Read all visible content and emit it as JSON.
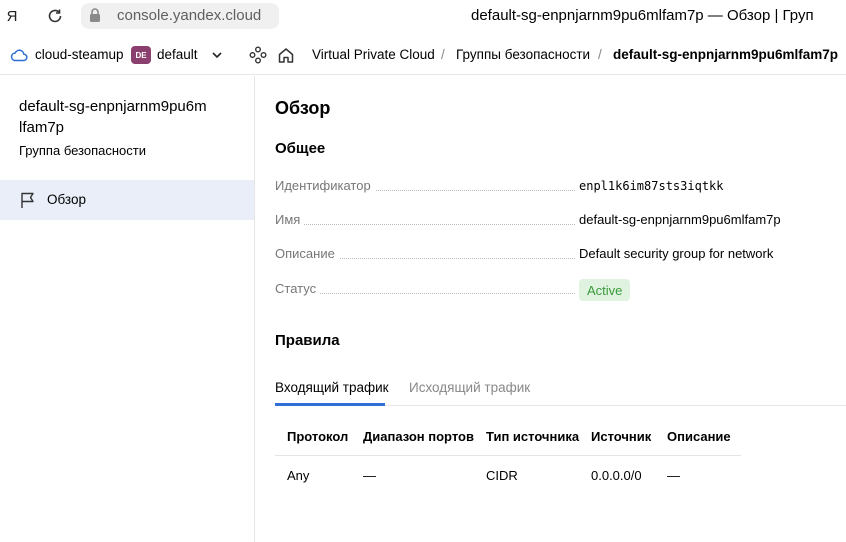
{
  "browser": {
    "logo": "Я",
    "address": "console.yandex.cloud",
    "tab_title": "default-sg-enpnjarnm9pu6mlfam7p — Обзор | Груп"
  },
  "header": {
    "cloud_name": "cloud-steamup",
    "folder_badge": "DE",
    "folder_name": "default",
    "breadcrumbs": [
      {
        "label": "Virtual Private Cloud"
      },
      {
        "label": "Группы безопасности"
      },
      {
        "label": "default-sg-enpnjarnm9pu6mlfam7p"
      }
    ],
    "separator": "/"
  },
  "sidebar": {
    "resource_name": "default-sg-enpnjarnm9pu6mlfam7p",
    "resource_type": "Группа безопасности",
    "items": [
      {
        "label": "Обзор",
        "icon": "flag-icon",
        "active": true
      }
    ]
  },
  "main": {
    "title": "Обзор",
    "general_title": "Общее",
    "properties": [
      {
        "label": "Идентификатор",
        "value": "enpl1k6im87sts3iqtkk"
      },
      {
        "label": "Имя",
        "value": "default-sg-enpnjarnm9pu6mlfam7p"
      },
      {
        "label": "Описание",
        "value": "Default security group for network"
      },
      {
        "label": "Статус",
        "value": "Active"
      }
    ],
    "rules_title": "Правила",
    "tabs": [
      {
        "label": "Входящий трафик",
        "active": true
      },
      {
        "label": "Исходящий трафик",
        "active": false
      }
    ],
    "table": {
      "headers": [
        "Протокол",
        "Диапазон портов",
        "Тип источника",
        "Источник",
        "Описание"
      ],
      "rows": [
        [
          "Any",
          "—",
          "CIDR",
          "0.0.0.0/0",
          "—"
        ]
      ]
    }
  },
  "colors": {
    "accent": "#2f6fd6",
    "active_nav_bg": "#e9eef9",
    "status_bg": "#dff3e0",
    "status_text": "#3a9a3a",
    "folder_badge": "#8b3f6f"
  }
}
